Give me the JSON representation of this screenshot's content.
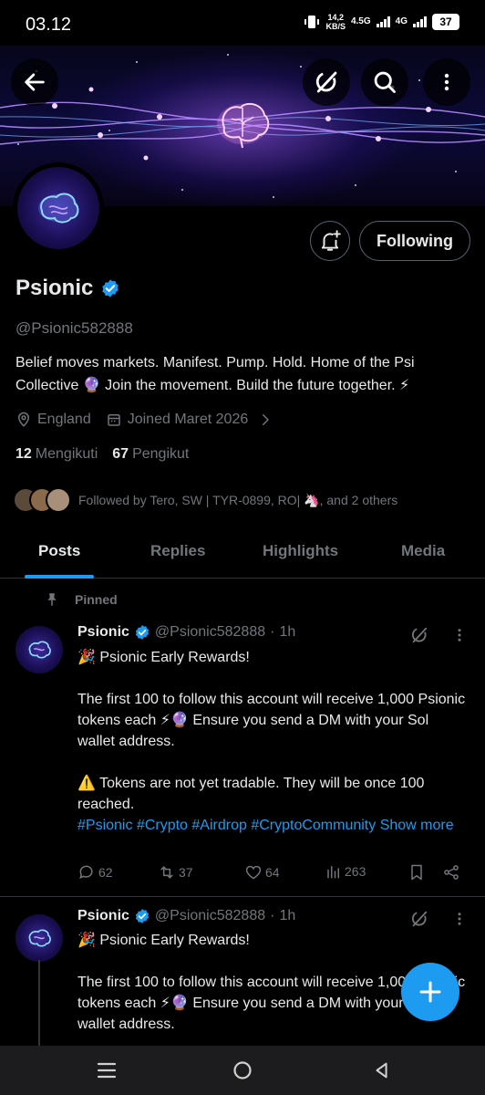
{
  "status_bar": {
    "time": "03.12",
    "speed_value": "14,2",
    "speed_unit": "KB/S",
    "net1": "4.5G",
    "net2": "4G",
    "battery": "37"
  },
  "header": {
    "back_icon": "arrow-left-icon",
    "grok_icon": "slash-circle-icon",
    "search_icon": "search-icon",
    "more_icon": "more-vertical-icon"
  },
  "profile": {
    "name": "Psionic",
    "handle": "@Psionic582888",
    "bio": "Belief moves markets. Manifest. Pump. Hold. Home of the Psi Collective 🔮 Join the movement. Build the future together. ⚡",
    "location": "England",
    "joined": "Joined Maret 2026",
    "following_count": "12",
    "following_label": "Mengikuti",
    "followers_count": "67",
    "followers_label": "Pengikut",
    "followed_by": "Followed by Tero, SW | TYR-0899, RO| 🦄, and 2 others",
    "follow_button": "Following"
  },
  "tabs": [
    {
      "label": "Posts",
      "active": true
    },
    {
      "label": "Replies"
    },
    {
      "label": "Highlights"
    },
    {
      "label": "Media"
    }
  ],
  "pinned_label": "Pinned",
  "tweets": [
    {
      "name": "Psionic",
      "handle": "@Psionic582888",
      "dot": "·",
      "time": "1h",
      "line1": "🎉 Psionic Early Rewards!",
      "line2": "The first 100 to follow this account will receive 1,000 Psionic tokens each ⚡🔮 Ensure you send a DM with your Sol wallet address.",
      "line3": "⚠️ Tokens are not yet tradable.  They will be once 100 reached.",
      "hashtags": "#Psionic #Crypto #Airdrop #CryptoCommunity",
      "show_more": "Show more",
      "replies": "62",
      "reposts": "37",
      "likes": "64",
      "views": "263"
    },
    {
      "name": "Psionic",
      "handle": "@Psionic582888",
      "dot": "·",
      "time": "1h",
      "line1": "🎉 Psionic Early Rewards!",
      "line2": "The first 100 to follow this account will receive 1,000 Psionic tokens each ⚡🔮 Ensure you send a DM with your Sol wallet address."
    }
  ],
  "colors": {
    "accent": "#1d9bf0",
    "background": "#000000",
    "muted": "#71767b",
    "text": "#e7e9ea"
  }
}
